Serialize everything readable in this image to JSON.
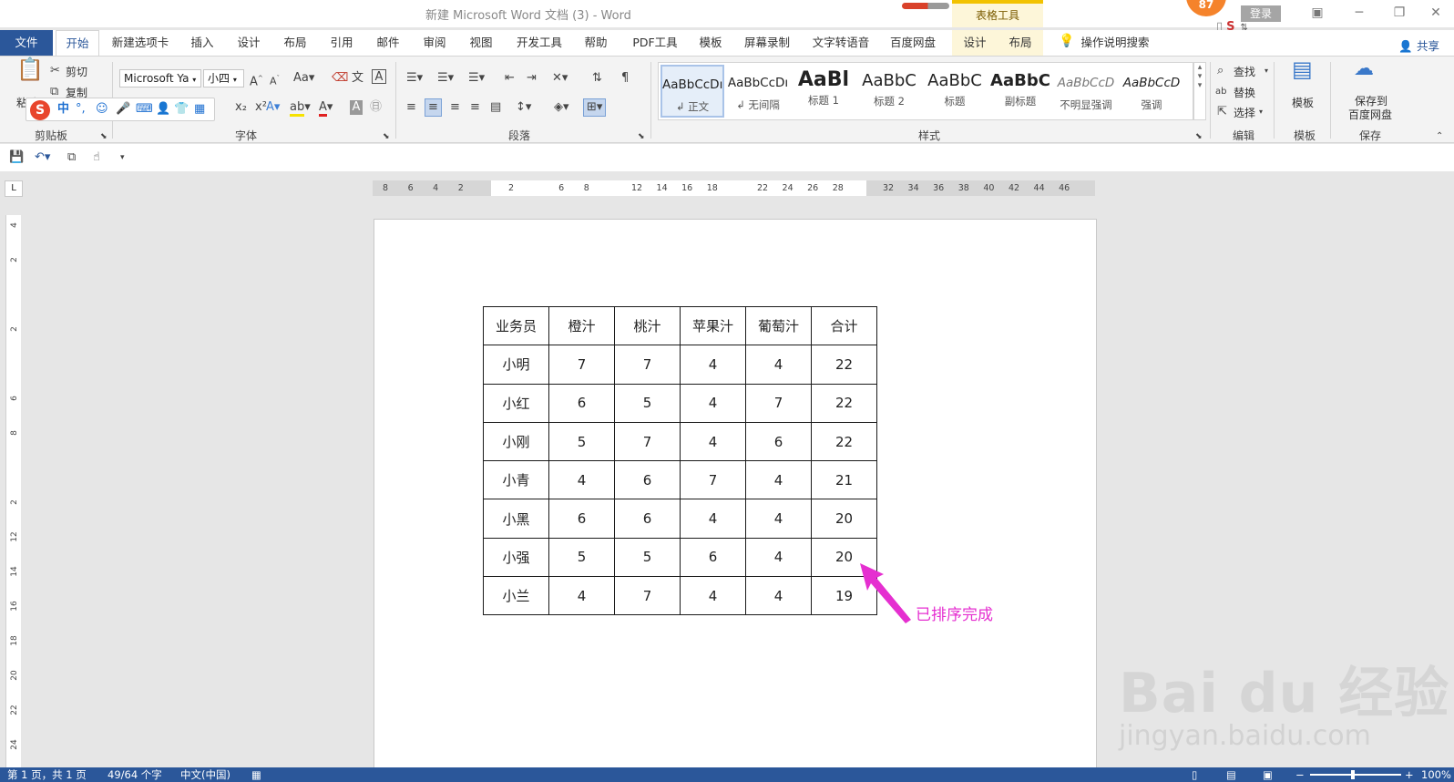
{
  "titlebar": {
    "title": "新建 Microsoft Word 文档 (3)  -  Word",
    "context_tab_group": "表格工具",
    "badge": "87",
    "login": "登录"
  },
  "tabs": {
    "file": "文件",
    "items": [
      "开始",
      "新建选项卡",
      "插入",
      "设计",
      "布局",
      "引用",
      "邮件",
      "审阅",
      "视图",
      "开发工具",
      "帮助",
      "PDF工具",
      "模板",
      "屏幕录制",
      "文字转语音",
      "百度网盘"
    ],
    "context_items": [
      "设计",
      "布局"
    ],
    "tell_me": "操作说明搜索",
    "share": "共享"
  },
  "ribbon": {
    "clipboard": {
      "label": "剪贴板",
      "paste": "粘贴",
      "cut": "剪切",
      "copy": "复制"
    },
    "font": {
      "label": "字体",
      "font_name": "Microsoft Ya",
      "font_size": "小四"
    },
    "paragraph": {
      "label": "段落"
    },
    "styles": {
      "label": "样式",
      "items": [
        {
          "sample": "AaBbCcDı",
          "name": "↲ 正文"
        },
        {
          "sample": "AaBbCcDı",
          "name": "↲ 无间隔"
        },
        {
          "sample": "AaBl",
          "name": "标题 1"
        },
        {
          "sample": "AaBbC",
          "name": "标题 2"
        },
        {
          "sample": "AaBbC",
          "name": "标题"
        },
        {
          "sample": "AaBbC",
          "name": "副标题"
        },
        {
          "sample": "AaBbCcD",
          "name": "不明显强调"
        },
        {
          "sample": "AaBbCcD",
          "name": "强调"
        }
      ]
    },
    "editing": {
      "label": "编辑",
      "find": "查找",
      "replace": "替换",
      "select": "选择"
    },
    "templates": {
      "label": "模板",
      "button": "模板"
    },
    "save": {
      "label": "保存",
      "button_line1": "保存到",
      "button_line2": "百度网盘"
    }
  },
  "ime": {
    "mode": "中"
  },
  "ruler": {
    "h_ticks": [
      "8",
      "6",
      "4",
      "2",
      "",
      "2",
      "",
      "6",
      "8",
      "",
      "12",
      "14",
      "16",
      "18",
      "",
      "22",
      "24",
      "26",
      "28",
      "",
      "32",
      "34",
      "36",
      "38",
      "40",
      "42",
      "44",
      "46"
    ],
    "v_ticks": [
      "4",
      "2",
      "",
      "2",
      "",
      "6",
      "8",
      "",
      "2",
      "12",
      "14",
      "16",
      "18",
      "20",
      "22",
      "24"
    ],
    "corner": "L"
  },
  "table": {
    "header": [
      "业务员",
      "橙汁",
      "桃汁",
      "苹果汁",
      "葡萄汁",
      "合计"
    ],
    "rows": [
      [
        "小明",
        "7",
        "7",
        "4",
        "4",
        "22"
      ],
      [
        "小红",
        "6",
        "5",
        "4",
        "7",
        "22"
      ],
      [
        "小刚",
        "5",
        "7",
        "4",
        "6",
        "22"
      ],
      [
        "小青",
        "4",
        "6",
        "7",
        "4",
        "21"
      ],
      [
        "小黑",
        "6",
        "6",
        "4",
        "4",
        "20"
      ],
      [
        "小强",
        "5",
        "5",
        "6",
        "4",
        "20"
      ],
      [
        "小兰",
        "4",
        "7",
        "4",
        "4",
        "19"
      ]
    ]
  },
  "annotation": {
    "text": "已排序完成",
    "color": "#e52fd0"
  },
  "watermark": {
    "main": "Bai du 经验",
    "sub": "jingyan.baidu.com"
  },
  "statusbar": {
    "page": "第 1 页，共 1 页",
    "words": "49/64 个字",
    "language": "中文(中国)",
    "zoom": "100%"
  },
  "colors": {
    "accent": "#2b579a",
    "context_tab": "#fdf6d9"
  }
}
